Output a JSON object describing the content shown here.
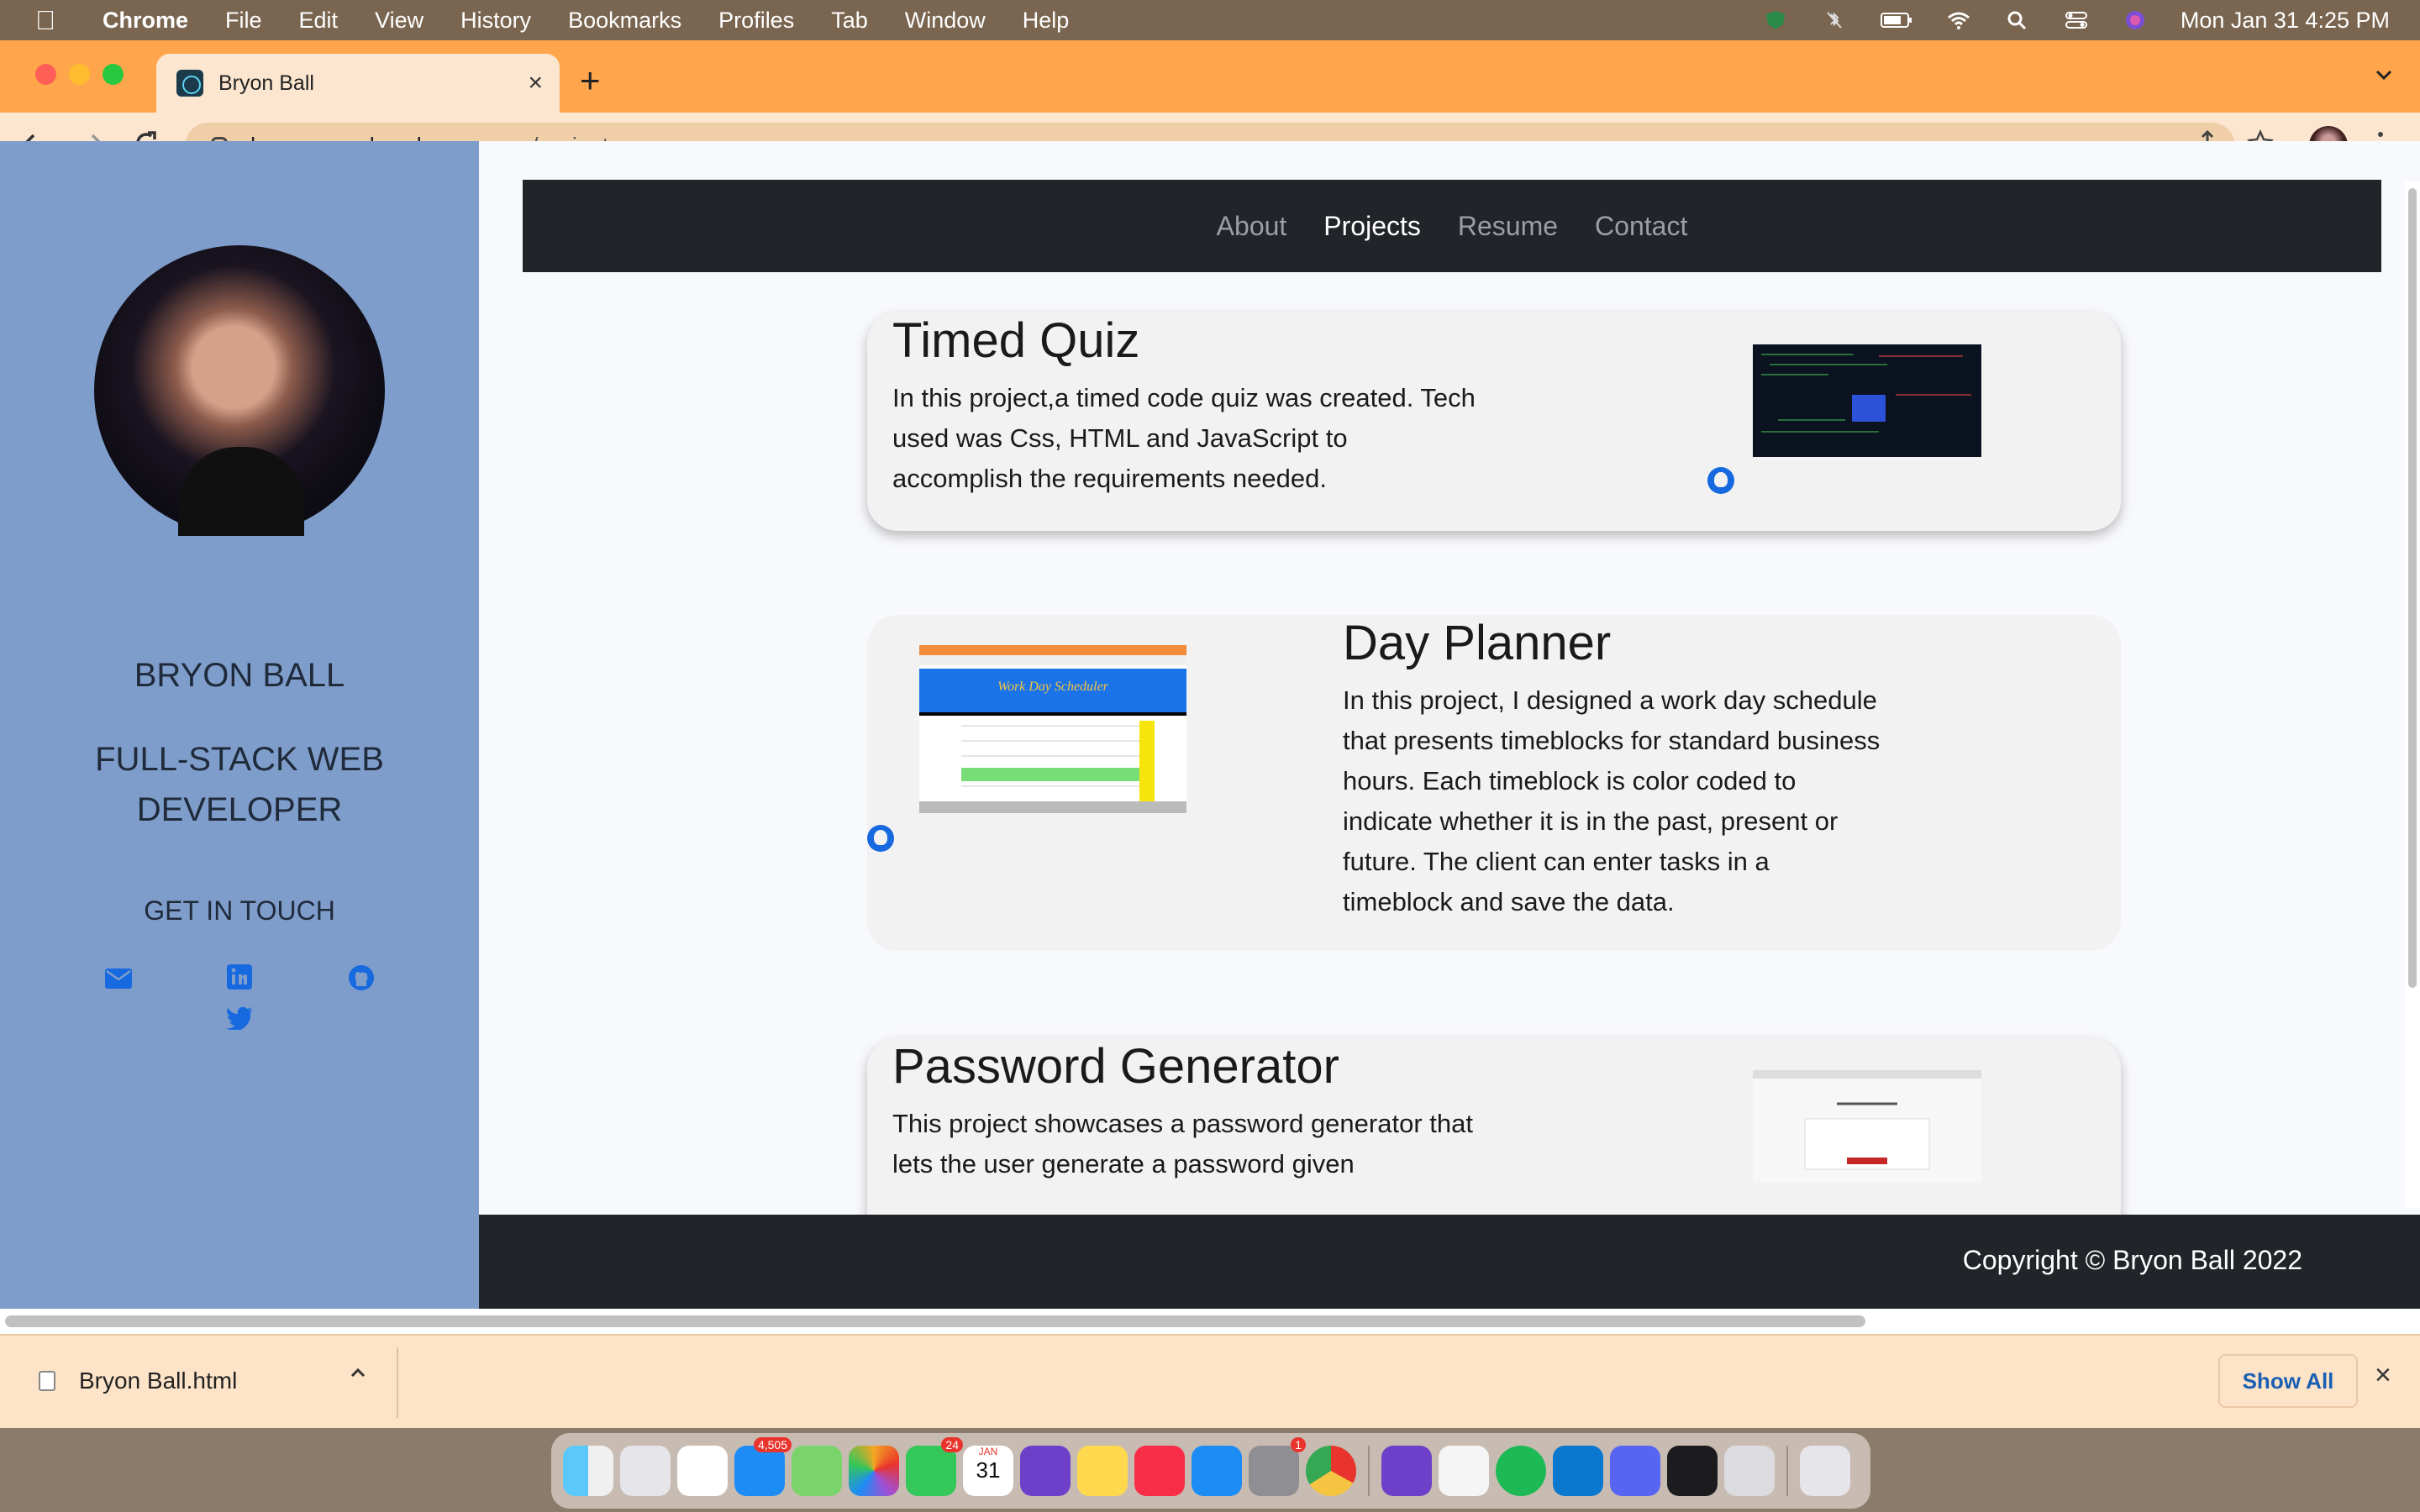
{
  "menubar": {
    "apple": "",
    "items": [
      "Chrome",
      "File",
      "Edit",
      "View",
      "History",
      "Bookmarks",
      "Profiles",
      "Tab",
      "Window",
      "Help"
    ],
    "datetime": "Mon Jan 31  4:25 PM"
  },
  "browser": {
    "tab_title": "Bryon Ball",
    "tab_close": "×",
    "new_tab": "+",
    "url_host": "bryonmern.herokuapp.com",
    "url_path": "/project"
  },
  "sidebar": {
    "name": "BRYON BALL",
    "role": "FULL-STACK WEB DEVELOPER",
    "get_in_touch": "GET IN TOUCH",
    "social_icons": [
      "envelope-icon",
      "linkedin-icon",
      "github-icon",
      "twitter-icon"
    ]
  },
  "nav": {
    "items": [
      {
        "label": "About",
        "active": false
      },
      {
        "label": "Projects",
        "active": true
      },
      {
        "label": "Resume",
        "active": false
      },
      {
        "label": "Contact",
        "active": false
      }
    ]
  },
  "projects": [
    {
      "title": "Timed Quiz",
      "description": "In this project,a timed code quiz was created. Tech used was Css, HTML and JavaScript to accomplish the requirements needed."
    },
    {
      "title": "Day Planner",
      "description": "In this project, I designed a work day schedule that presents timeblocks for standard business hours. Each timeblock is color coded to indicate whether it is in the past, present or future. The client can enter tasks in a timeblock and save the data.",
      "thumb_title": "Work Day Scheduler"
    },
    {
      "title": "Password Generator",
      "description": "This project showcases a password generator that lets the user generate a password given"
    }
  ],
  "footer": {
    "copyright": "Copyright © Bryon Ball 2022"
  },
  "download_bar": {
    "filename": "Bryon Ball.html",
    "show_all": "Show All",
    "close": "×"
  },
  "dock": {
    "badges": {
      "mail": "4,505",
      "facetime": "24",
      "settings": "1"
    },
    "calendar_month": "JAN",
    "calendar_day": "31"
  }
}
